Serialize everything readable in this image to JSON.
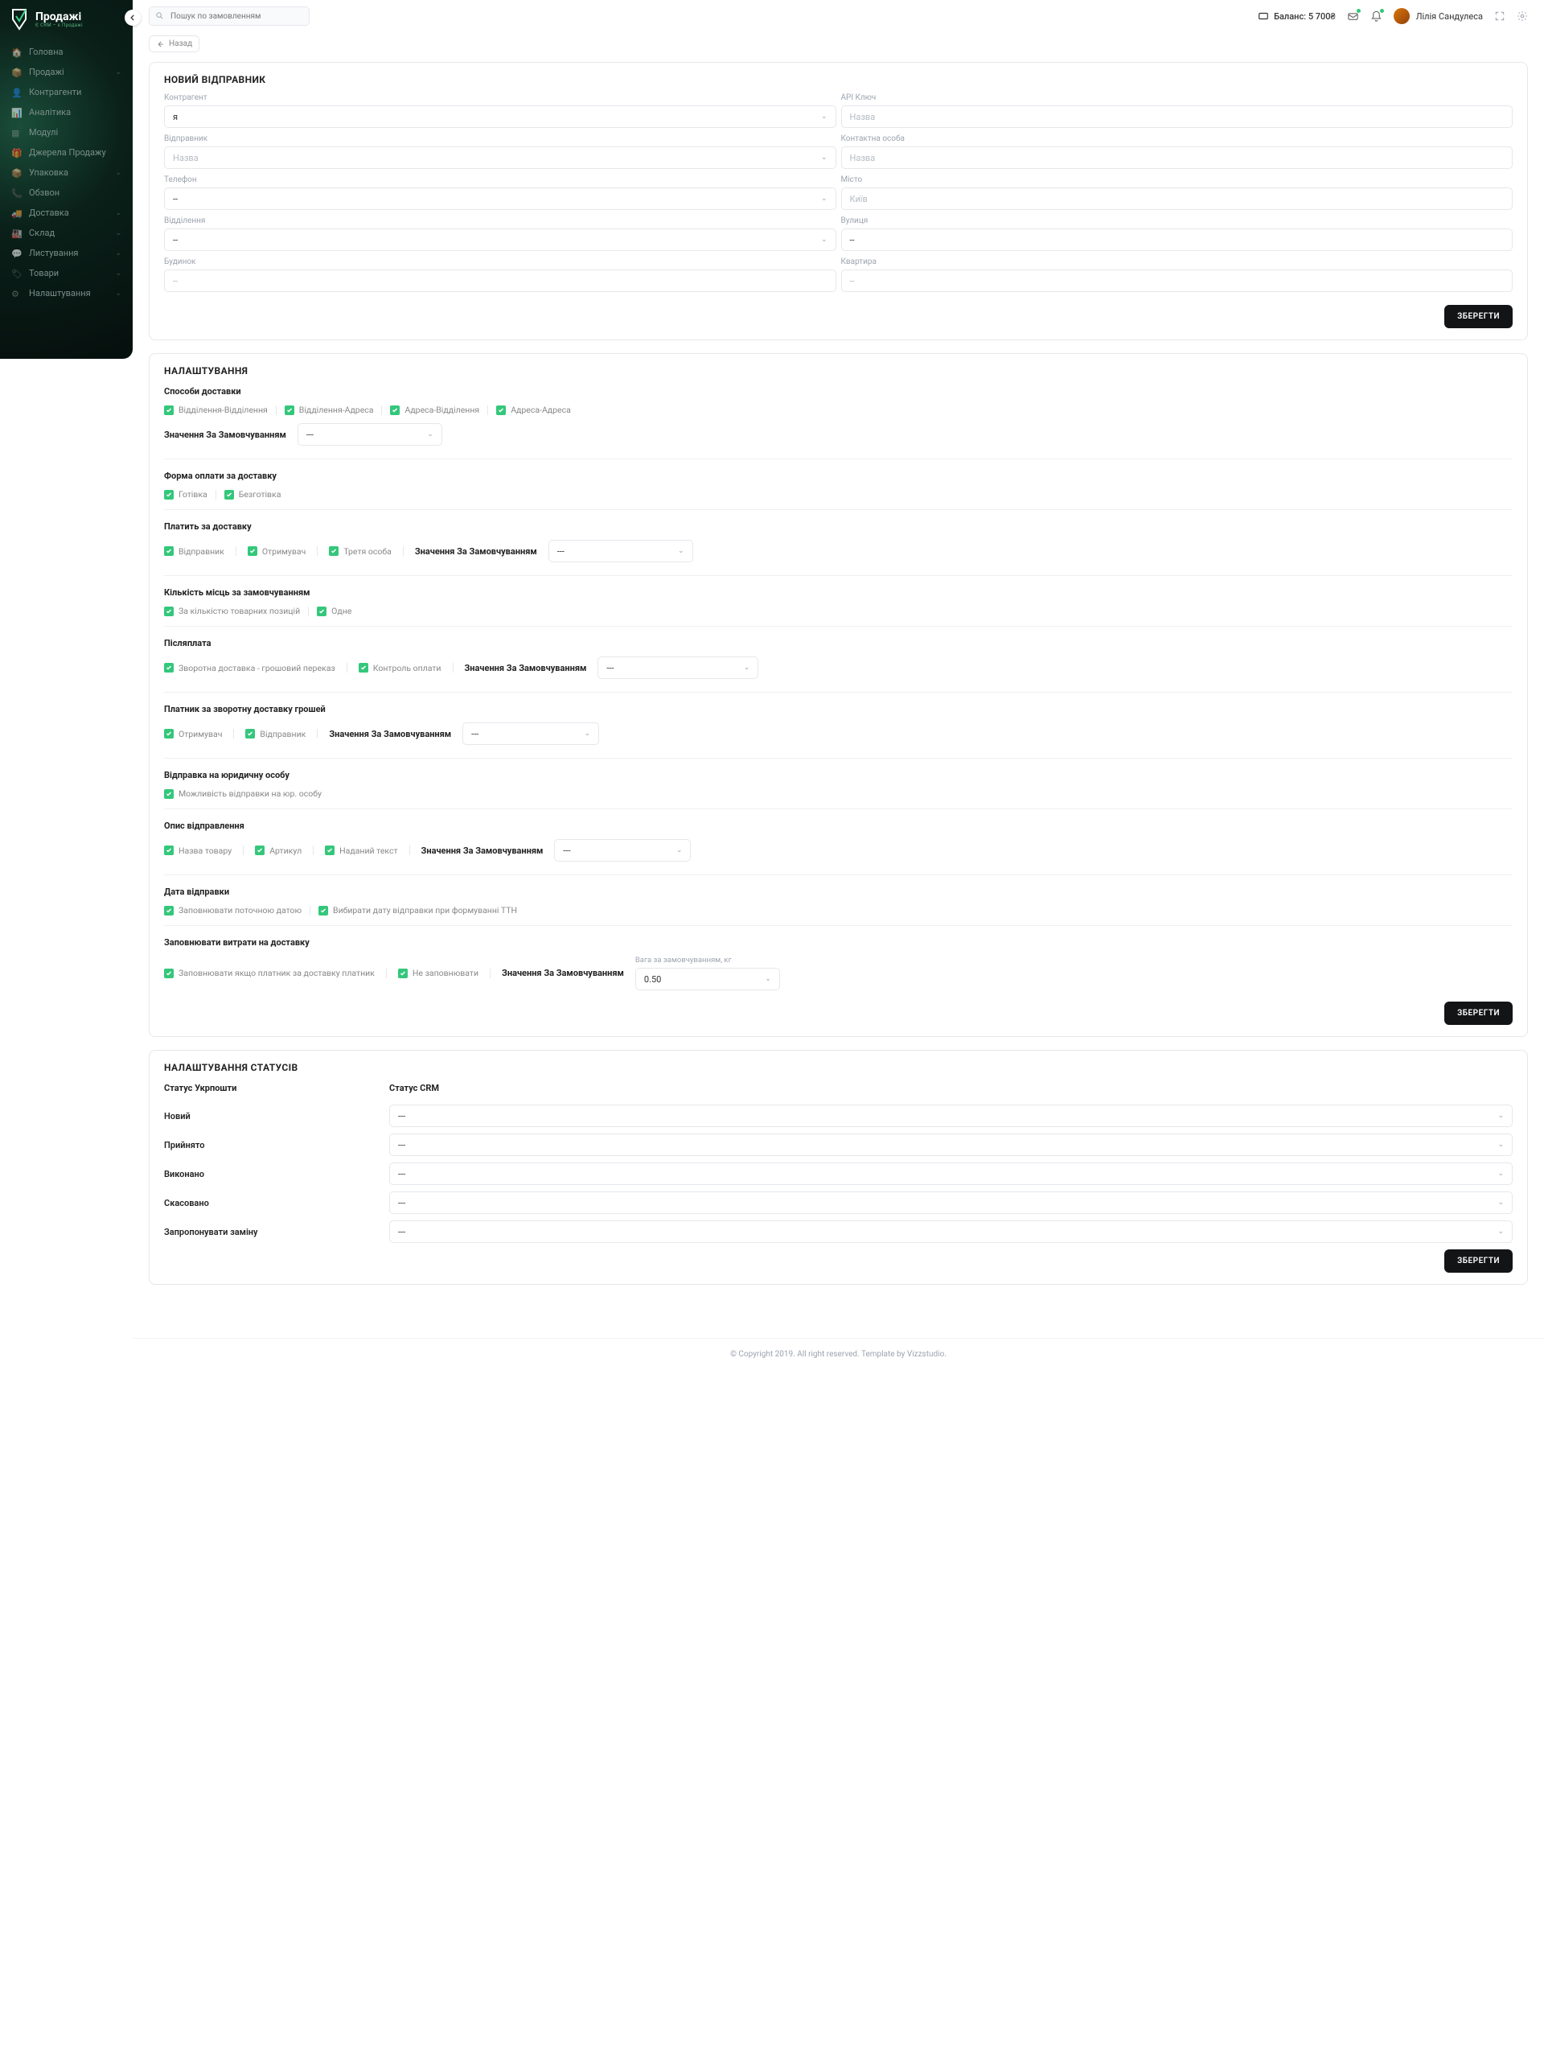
{
  "brand": {
    "name": "Продажі",
    "tagline": "Є CRM – є Продажі"
  },
  "sidebar": {
    "items": [
      {
        "label": "Головна",
        "chev": false
      },
      {
        "label": "Продажі",
        "chev": true
      },
      {
        "label": "Контрагенти",
        "chev": false
      },
      {
        "label": "Аналітика",
        "chev": false
      },
      {
        "label": "Модулі",
        "chev": false
      },
      {
        "label": "Джерела Продажу",
        "chev": false
      },
      {
        "label": "Упаковка",
        "chev": true
      },
      {
        "label": "Обзвон",
        "chev": false
      },
      {
        "label": "Доставка",
        "chev": true
      },
      {
        "label": "Склад",
        "chev": true
      },
      {
        "label": "Листування",
        "chev": true
      },
      {
        "label": "Товари",
        "chev": true
      },
      {
        "label": "Налаштування",
        "chev": true
      }
    ]
  },
  "topbar": {
    "search_placeholder": "Пошук по замовленням",
    "balance_label": "Баланс: 5 700₴",
    "username": "Лілія Сандулеса"
  },
  "back_label": "Назад",
  "card1": {
    "title": "НОВИЙ ВІДПРАВНИК",
    "save": "ЗБЕРЕГТИ",
    "fields": {
      "contragent": {
        "label": "Контрагент",
        "value": "я"
      },
      "api_key": {
        "label": "API Ключ",
        "placeholder": "Назва"
      },
      "sender": {
        "label": "Відправник",
        "placeholder": "Назва"
      },
      "contact": {
        "label": "Контактна особа",
        "placeholder": "Назва"
      },
      "phone": {
        "label": "Телефон",
        "value": "--"
      },
      "city": {
        "label": "Місто",
        "placeholder": "Київ"
      },
      "branch": {
        "label": "Відділення",
        "value": "--"
      },
      "street": {
        "label": "Вулиця",
        "value": "--"
      },
      "building": {
        "label": "Будинок",
        "placeholder": "--"
      },
      "apartment": {
        "label": "Квартира",
        "placeholder": "--"
      }
    }
  },
  "card2": {
    "title": "НАЛАШТУВАННЯ",
    "save": "ЗБЕРЕГТИ",
    "delivery_methods": {
      "header": "Способи доставки",
      "opts": [
        "Відділення-Відділення",
        "Відділення-Адреса",
        "Адреса-Відділення",
        "Адреса-Адреса"
      ],
      "default_label": "Значення За Замовчуванням",
      "default_value": "---"
    },
    "payment_form": {
      "header": "Форма оплати за доставку",
      "opts": [
        "Готівка",
        "Безготівка"
      ]
    },
    "payer": {
      "header": "Платить за доставку",
      "opts": [
        "Відправник",
        "Отримувач",
        "Третя особа"
      ],
      "default_label": "Значення За Замовчуванням",
      "default_value": "---"
    },
    "seats": {
      "header": "Кількість місць за замовчуванням",
      "opts": [
        "За кількістю товарних позицій",
        "Одне"
      ]
    },
    "cod": {
      "header": "Післяплата",
      "opts": [
        "Зворотна доставка - грошовий переказ",
        "Контроль оплати"
      ],
      "default_label": "Значення За Замовчуванням",
      "default_value": "---"
    },
    "back_payer": {
      "header": "Платник за зворотну доставку грошей",
      "opts": [
        "Отримувач",
        "Відправник"
      ],
      "default_label": "Значення За Замовчуванням",
      "default_value": "---"
    },
    "legal": {
      "header": "Відправка на юридичну особу",
      "opts": [
        "Можливість відправки на юр. особу"
      ]
    },
    "description": {
      "header": "Опис відправлення",
      "opts": [
        "Назва товару",
        "Артикул",
        "Наданий текст"
      ],
      "default_label": "Значення За Замовчуванням",
      "default_value": "---"
    },
    "send_date": {
      "header": "Дата відправки",
      "opts": [
        "Заповнювати поточною датою",
        "Вибирати дату відправки при формуванні ТТН"
      ]
    },
    "costs": {
      "header": "Заповнювати витрати на доставку",
      "opts": [
        "Заповнювати якщо платник за доставку платник",
        "Не заповнювати"
      ],
      "default_label": "Значення За Замовчуванням",
      "weight_label": "Вага за замовчуванням, кг",
      "weight_value": "0.50"
    }
  },
  "card3": {
    "title": "НАЛАШТУВАННЯ СТАТУСІВ",
    "save": "ЗБЕРЕГТИ",
    "col1": "Статус Укрпошти",
    "col2": "Статус CRM",
    "rows": [
      {
        "label": "Новий",
        "value": "---"
      },
      {
        "label": "Прийнято",
        "value": "---"
      },
      {
        "label": "Виконано",
        "value": "---"
      },
      {
        "label": "Скасовано",
        "value": "---"
      },
      {
        "label": "Запропонувати заміну",
        "value": "---"
      }
    ]
  },
  "footer": "© Copyright 2019. All right reserved. Template by Vizzstudio."
}
